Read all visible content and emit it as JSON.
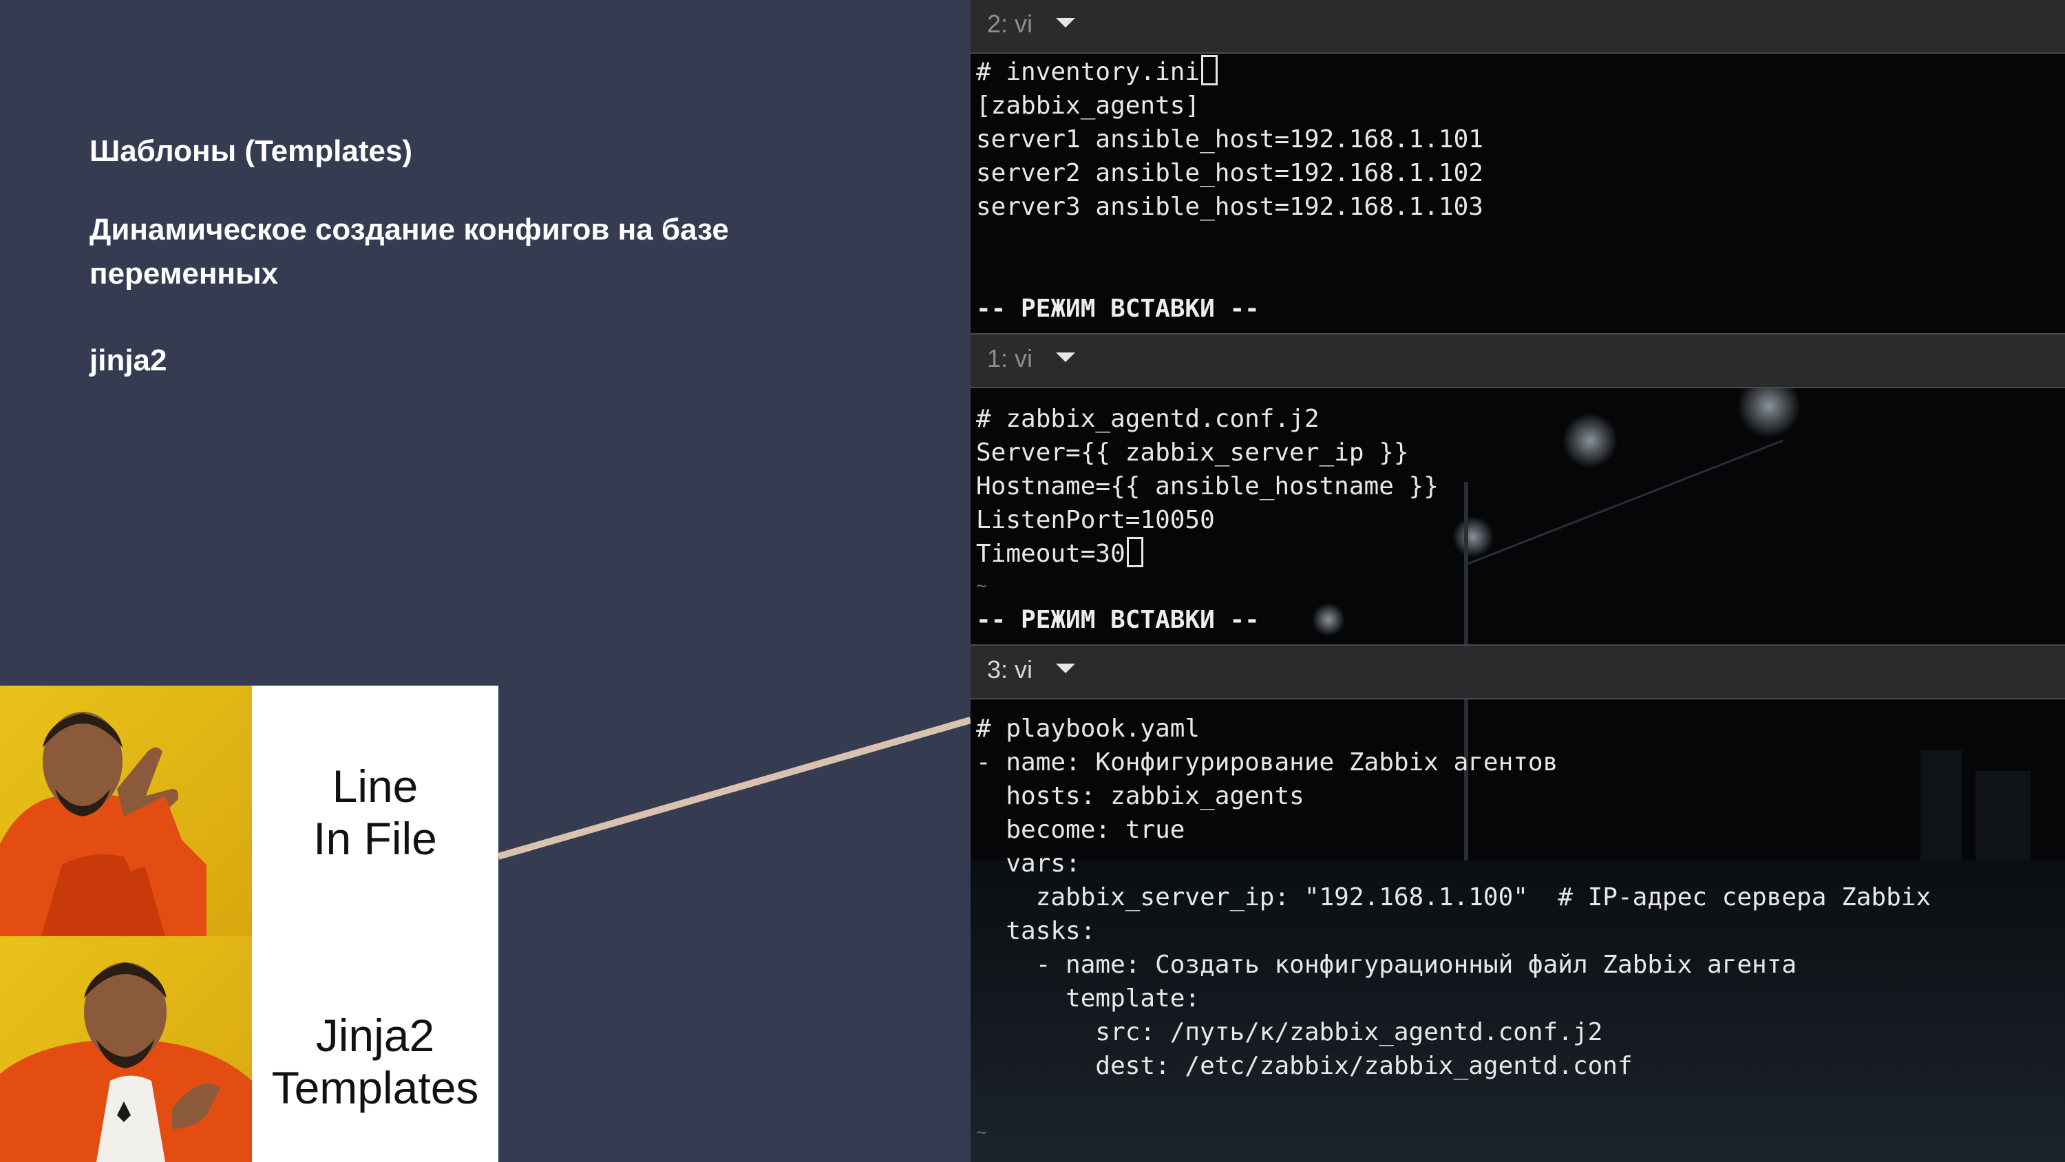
{
  "slide": {
    "title": "Шаблоны (Templates)",
    "subtitle": "Динамическое создание конфигов на базе переменных",
    "tag": "jinja2"
  },
  "meme": {
    "top_caption": "Line\nIn File",
    "bottom_caption": "Jinja2\nTemplates"
  },
  "terminal": {
    "panes": [
      {
        "tab_label": "2: vi",
        "lines": [
          "# inventory.ini",
          "[zabbix_agents]",
          "server1 ansible_host=192.168.1.101",
          "server2 ansible_host=192.168.1.102",
          "server3 ansible_host=192.168.1.103"
        ],
        "mode": "-- РЕЖИМ ВСТАВКИ --"
      },
      {
        "tab_label": "1: vi",
        "lines": [
          "# zabbix_agentd.conf.j2",
          "Server={{ zabbix_server_ip }}",
          "Hostname={{ ansible_hostname }}",
          "ListenPort=10050",
          "Timeout=30"
        ],
        "tilde": "~",
        "mode": "-- РЕЖИМ ВСТАВКИ --"
      },
      {
        "tab_label": "3: vi",
        "lines": [
          "# playbook.yaml",
          "- name: Конфигурирование Zabbix агентов",
          "  hosts: zabbix_agents",
          "  become: true",
          "  vars:",
          "    zabbix_server_ip: \"192.168.1.100\"  # IP-адрес сервера Zabbix",
          "",
          "  tasks:",
          "    - name: Создать конфигурационный файл Zabbix агента",
          "      template:",
          "        src: /путь/к/zabbix_agentd.conf.j2",
          "        dest: /etc/zabbix/zabbix_agentd.conf"
        ],
        "tilde": "~"
      }
    ]
  },
  "colors": {
    "slide_background": "#353c51",
    "terminal_background": "#050608",
    "pane_header": "#2b2b2e",
    "connector_line": "#d9c3b0"
  }
}
